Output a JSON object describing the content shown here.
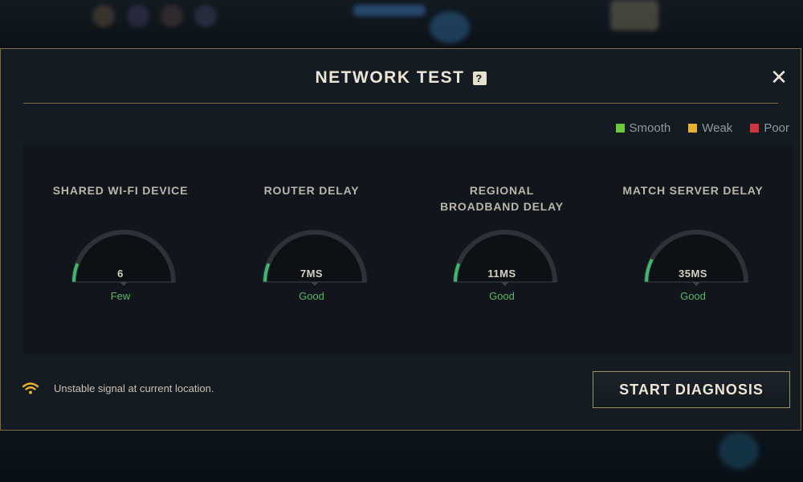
{
  "dialog": {
    "title": "NETWORK TEST",
    "help_icon": "?",
    "close_icon": "✕"
  },
  "legend": [
    {
      "label": "Smooth",
      "color": "#6cc93a"
    },
    {
      "label": "Weak",
      "color": "#e8b02e"
    },
    {
      "label": "Poor",
      "color": "#d0343c"
    }
  ],
  "metrics": [
    {
      "label": "SHARED WI-FI DEVICE",
      "value": "6",
      "status": "Few",
      "level": 0.12
    },
    {
      "label": "ROUTER DELAY",
      "value": "7MS",
      "status": "Good",
      "level": 0.12
    },
    {
      "label": "REGIONAL\nBROADBAND DELAY",
      "value": "11MS",
      "status": "Good",
      "level": 0.12
    },
    {
      "label": "MATCH SERVER DELAY",
      "value": "35MS",
      "status": "Good",
      "level": 0.15
    }
  ],
  "gauge_color": "#3fb86b",
  "footer": {
    "status_text": "Unstable signal at current location.",
    "wifi_icon": "wifi-weak-icon",
    "diagnosis_button": "START DIAGNOSIS"
  }
}
